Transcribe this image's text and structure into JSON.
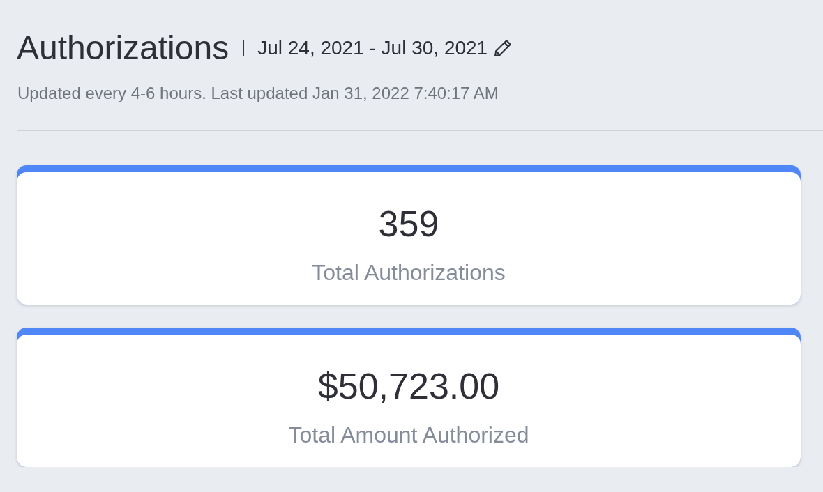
{
  "header": {
    "title": "Authorizations",
    "date_range": "Jul 24, 2021 - Jul 30, 2021",
    "updated_note": "Updated every 4-6 hours. Last updated Jan 31, 2022 7:40:17 AM"
  },
  "stats": [
    {
      "value": "359",
      "label": "Total Authorizations"
    },
    {
      "value": "$50,723.00",
      "label": "Total Amount Authorized"
    }
  ]
}
